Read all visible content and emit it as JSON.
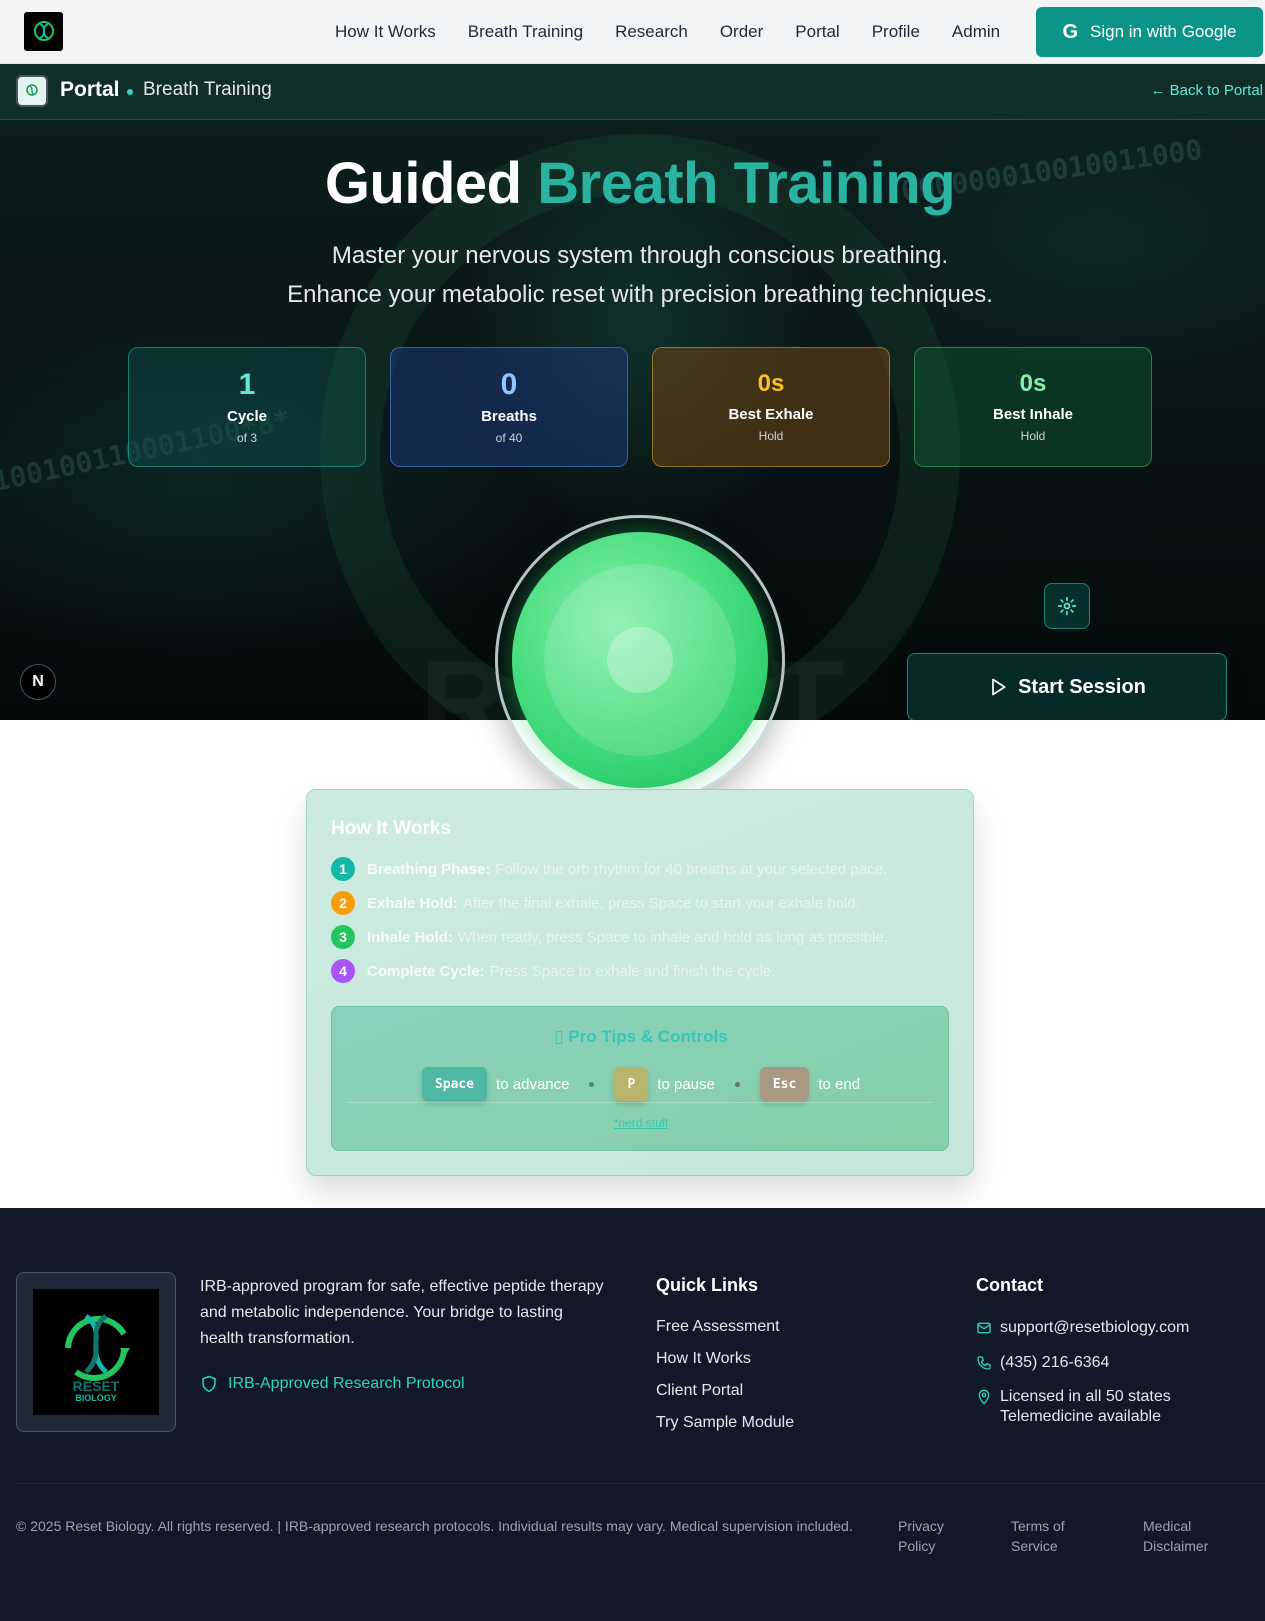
{
  "nav": {
    "links": [
      "How It Works",
      "Breath Training",
      "Research",
      "Order",
      "Portal",
      "Profile",
      "Admin"
    ],
    "signin": "Sign in with Google",
    "google_glyph": "G"
  },
  "portal_bar": {
    "title": "Portal",
    "subtitle": "Breath Training",
    "back": "← Back to Portal"
  },
  "hero": {
    "title_plain": "Guided",
    "title_accent": "Breath Training",
    "subtitle_line1": "Master your nervous system through conscious breathing.",
    "subtitle_line2": "Enhance your metabolic reset with precision breathing techniques.",
    "binary_text_1": "100100110001100*8*",
    "binary_text_2": "000000010010011000",
    "watermark": "RESET"
  },
  "stats": [
    {
      "value": "1",
      "label": "Cycle",
      "sub": "of 3"
    },
    {
      "value": "0",
      "label": "Breaths",
      "sub": "of 40"
    },
    {
      "value": "0s",
      "label": "Best Exhale",
      "sub": "Hold"
    },
    {
      "value": "0s",
      "label": "Best Inhale",
      "sub": "Hold"
    }
  ],
  "controls": {
    "start": "Start Session",
    "n_badge": "N"
  },
  "how_it_works": {
    "title": "How It Works",
    "steps": [
      {
        "num": "1",
        "label": "Breathing Phase:",
        "text": "Follow the orb rhythm for 40 breaths at your selected pace.",
        "color": "#14b8a6"
      },
      {
        "num": "2",
        "label": "Exhale Hold:",
        "text": "After the final exhale, press Space to start your exhale hold.",
        "color": "#f59e0b"
      },
      {
        "num": "3",
        "label": "Inhale Hold:",
        "text": "When ready, press Space to inhale and hold as long as possible.",
        "color": "#22c55e"
      },
      {
        "num": "4",
        "label": "Complete Cycle:",
        "text": "Press Space to exhale and finish the cycle.",
        "color": "#a855f7"
      }
    ]
  },
  "tips": {
    "title": "▯ Pro Tips & Controls",
    "keys": [
      {
        "key": "Space",
        "action": "to advance",
        "color": "#4fb8a2"
      },
      {
        "key": "P",
        "action": "to pause",
        "color": "#b7b46c"
      },
      {
        "key": "Esc",
        "action": "to end",
        "color": "#a89a82"
      }
    ],
    "nerd_link": "*nerd stuff"
  },
  "footer": {
    "logo_text_1": "RESET",
    "logo_text_2": "BIOLOGY",
    "description": "IRB-approved program for safe, effective peptide therapy and metabolic independence. Your bridge to lasting health transformation.",
    "irb": "IRB-Approved Research Protocol",
    "quick_links_title": "Quick Links",
    "quick_links": [
      "Free Assessment",
      "How It Works",
      "Client Portal",
      "Try Sample Module"
    ],
    "contact_title": "Contact",
    "email": "support@resetbiology.com",
    "phone": "(435) 216-6364",
    "license_1": "Licensed in all 50 states",
    "license_2": "Telemedicine available",
    "copyright": "© 2025 Reset Biology. All rights reserved. | IRB-approved research protocols. Individual results may vary. Medical supervision included.",
    "legal": [
      "Privacy Policy",
      "Terms of Service",
      "Medical Disclaimer"
    ]
  },
  "colors": {
    "brand": "#0d9488",
    "accent": "#2ab3a0",
    "orb": "#4ade80",
    "footer_bg": "#111827"
  },
  "icons": [
    "logo-dna-icon",
    "google-icon",
    "gear-icon",
    "play-icon",
    "shield-icon",
    "mail-icon",
    "phone-icon",
    "map-pin-icon"
  ]
}
